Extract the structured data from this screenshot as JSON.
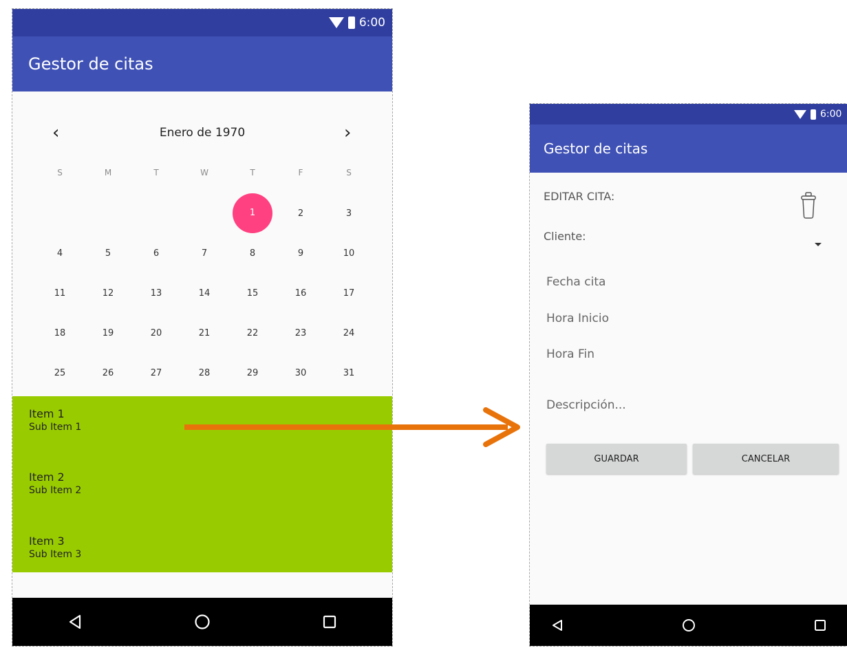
{
  "status": {
    "time": "6:00"
  },
  "app": {
    "title": "Gestor de citas"
  },
  "calendar": {
    "month_label": "Enero de 1970",
    "prev_glyph": "‹",
    "next_glyph": "›",
    "weekdays": [
      "S",
      "M",
      "T",
      "W",
      "T",
      "F",
      "S"
    ],
    "weeks": [
      [
        "",
        "",
        "",
        "",
        "1",
        "2",
        "3"
      ],
      [
        "4",
        "5",
        "6",
        "7",
        "8",
        "9",
        "10"
      ],
      [
        "11",
        "12",
        "13",
        "14",
        "15",
        "16",
        "17"
      ],
      [
        "18",
        "19",
        "20",
        "21",
        "22",
        "23",
        "24"
      ],
      [
        "25",
        "26",
        "27",
        "28",
        "29",
        "30",
        "31"
      ]
    ],
    "selected_day": "1",
    "selected_color": "#ff4081"
  },
  "list": {
    "background": "#99cc00",
    "items": [
      {
        "title": "Item 1",
        "subtitle": "Sub Item 1"
      },
      {
        "title": "Item 2",
        "subtitle": "Sub Item 2"
      },
      {
        "title": "Item 3",
        "subtitle": "Sub Item 3"
      }
    ]
  },
  "edit": {
    "heading": "EDITAR CITA:",
    "client_label": "Cliente:",
    "date_placeholder": "Fecha cita",
    "start_placeholder": "Hora Inicio",
    "end_placeholder": "Hora Fin",
    "description_placeholder": "Descripción...",
    "save_label": "GUARDAR",
    "cancel_label": "CANCELAR"
  },
  "colors": {
    "primary": "#3f51b5",
    "primary_dark": "#303f9f",
    "arrow": "#e8730b"
  },
  "icons": {
    "back": "back-triangle-icon",
    "home": "home-circle-icon",
    "recents": "recents-square-icon",
    "delete": "trash-icon"
  }
}
